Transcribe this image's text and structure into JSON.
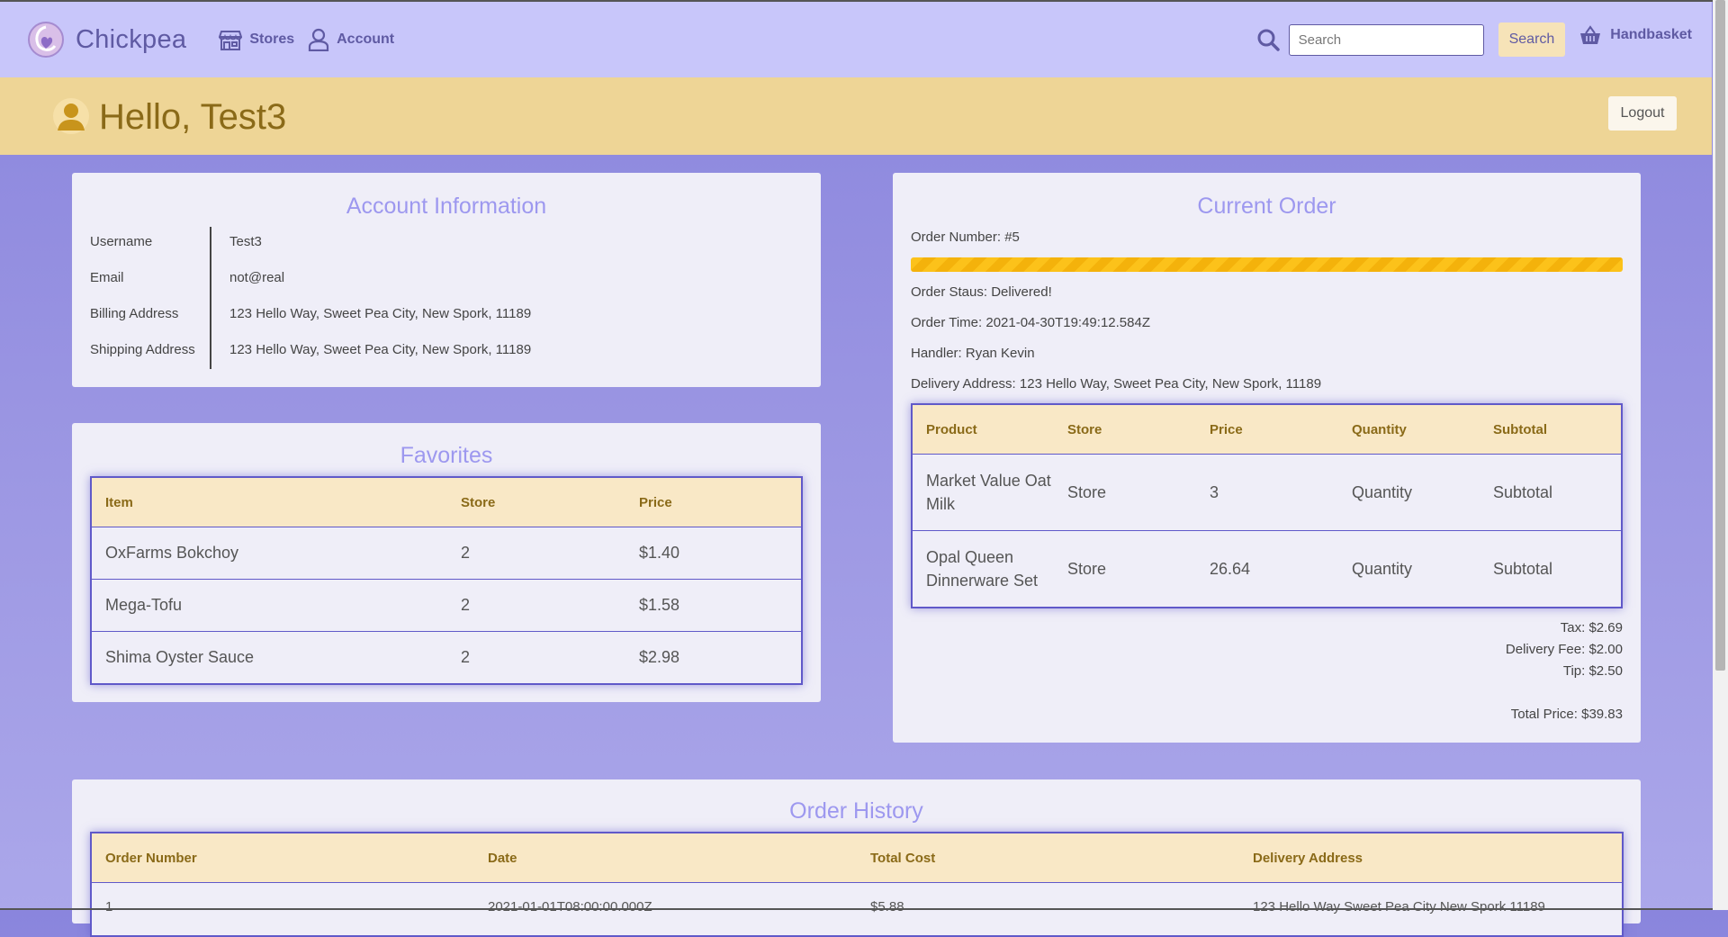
{
  "navbar": {
    "brand": "Chickpea",
    "stores_label": "Stores",
    "account_label": "Account",
    "search_placeholder": "Search",
    "search_button": "Search",
    "basket_label": "Handbasket"
  },
  "greeting": {
    "text": "Hello, Test3",
    "logout_label": "Logout"
  },
  "account": {
    "title": "Account Information",
    "rows": [
      {
        "label": "Username",
        "value": "Test3"
      },
      {
        "label": "Email",
        "value": "not@real"
      },
      {
        "label": "Billing Address",
        "value": "123 Hello Way, Sweet Pea City, New Spork, 11189"
      },
      {
        "label": "Shipping Address",
        "value": "123 Hello Way, Sweet Pea City, New Spork, 11189"
      }
    ]
  },
  "favorites": {
    "title": "Favorites",
    "headers": [
      "Item",
      "Store",
      "Price"
    ],
    "rows": [
      [
        "OxFarms Bokchoy",
        "2",
        "$1.40"
      ],
      [
        "Mega-Tofu",
        "2",
        "$1.58"
      ],
      [
        "Shima Oyster Sauce",
        "2",
        "$2.98"
      ]
    ]
  },
  "current_order": {
    "title": "Current Order",
    "order_number": "Order Number: #5",
    "progress": 1.0,
    "status": "Order Staus: Delivered!",
    "time": "Order Time: 2021-04-30T19:49:12.584Z",
    "handler": "Handler: Ryan Kevin",
    "address": "Delivery Address: 123 Hello Way, Sweet Pea City, New Spork, 11189",
    "headers": [
      "Product",
      "Store",
      "Price",
      "Quantity",
      "Subtotal"
    ],
    "rows": [
      [
        "Market Value Oat Milk",
        "Store",
        "3",
        "Quantity",
        "Subtotal"
      ],
      [
        "Opal Queen Dinnerware Set",
        "Store",
        "26.64",
        "Quantity",
        "Subtotal"
      ]
    ],
    "tax": "Tax: $2.69",
    "delivery_fee": "Delivery Fee: $2.00",
    "tip": "Tip: $2.50",
    "total": "Total Price: $39.83"
  },
  "history": {
    "title": "Order History",
    "headers": [
      "Order Number",
      "Date",
      "Total Cost",
      "Delivery Address"
    ],
    "rows": [
      [
        "1",
        "2021-01-01T08:00:00.000Z",
        "$5.88",
        "123 Hello Way Sweet Pea City New Spork 11189"
      ]
    ]
  },
  "colors": {
    "navbar": "#c8c6fa",
    "greeting_bar": "#eed596",
    "accent": "#5f5aa3",
    "card_title": "#9d98ef",
    "table_header": "#f9e8c6",
    "progress": "#fcc21a"
  }
}
